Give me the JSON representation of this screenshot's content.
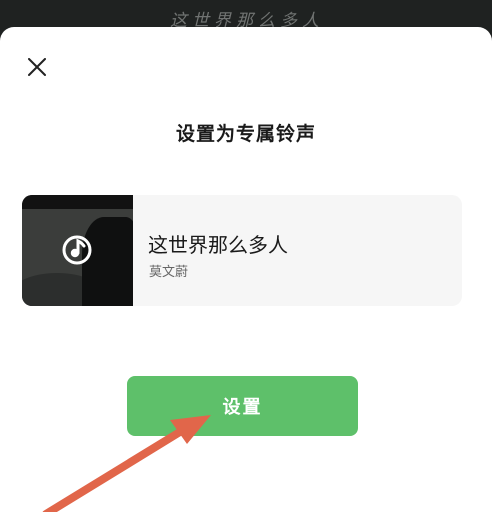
{
  "backdrop": {
    "text": "这世界那么多人"
  },
  "dialog": {
    "title": "设置为专属铃声",
    "close_icon": "close-icon"
  },
  "song": {
    "title": "这世界那么多人",
    "artist": "莫文蔚",
    "cover_icon": "music-play-icon"
  },
  "actions": {
    "set_label": "设置"
  },
  "colors": {
    "accent": "#5ec06a",
    "arrow": "#e1664a",
    "card_bg": "#f6f6f6"
  }
}
